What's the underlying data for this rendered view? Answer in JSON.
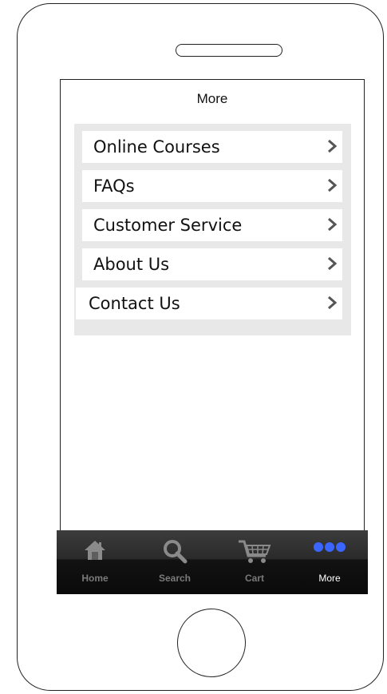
{
  "header": {
    "title": "More"
  },
  "menu": {
    "items": [
      {
        "label": "Online Courses"
      },
      {
        "label": "FAQs"
      },
      {
        "label": "Customer Service"
      },
      {
        "label": "About Us"
      },
      {
        "label": "Contact Us"
      }
    ]
  },
  "tabbar": {
    "tabs": [
      {
        "label": "Home",
        "icon": "home-icon"
      },
      {
        "label": "Search",
        "icon": "search-icon"
      },
      {
        "label": "Cart",
        "icon": "cart-icon"
      },
      {
        "label": "More",
        "icon": "more-dots-icon",
        "active": true
      }
    ],
    "active_color": "#3a66ff"
  },
  "colors": {
    "list_background": "#e8e8e8",
    "tabbar_background": "#1a1a1a"
  }
}
